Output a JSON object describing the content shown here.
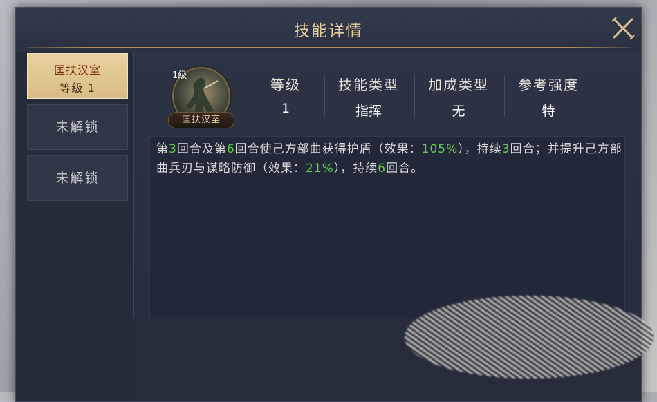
{
  "dialog": {
    "title": "技能详情"
  },
  "tabs": [
    {
      "name": "匡扶汉室",
      "level": "等级 1"
    },
    {
      "label": "未解锁"
    },
    {
      "label": "未解锁"
    }
  ],
  "skill": {
    "level_badge": "1级",
    "name": "匡扶汉室"
  },
  "stats": [
    {
      "label": "等级",
      "value": "1"
    },
    {
      "label": "技能类型",
      "value": "指挥"
    },
    {
      "label": "加成类型",
      "value": "无"
    },
    {
      "label": "参考强度",
      "value": "特"
    }
  ],
  "description": {
    "p1": "第",
    "n1": "3",
    "p2": "回合及第",
    "n2": "6",
    "p3": "回合使己方部曲获得护盾（效果：",
    "n3": "105%",
    "p4": "），持续",
    "n4": "3",
    "p5": "回合；并提升己方部曲兵刃与谋略防御（效果：",
    "n5": "21%",
    "p6": "），持续",
    "n6": "6",
    "p7": "回合。"
  },
  "colors": {
    "title": "#e7cf9a",
    "highlight_number": "#5fce4b",
    "active_tab": "#e0c690",
    "panel_bg": "#2a3040"
  },
  "icons": {
    "close": "close-x-icon",
    "skill": "skill-portrait-icon"
  }
}
